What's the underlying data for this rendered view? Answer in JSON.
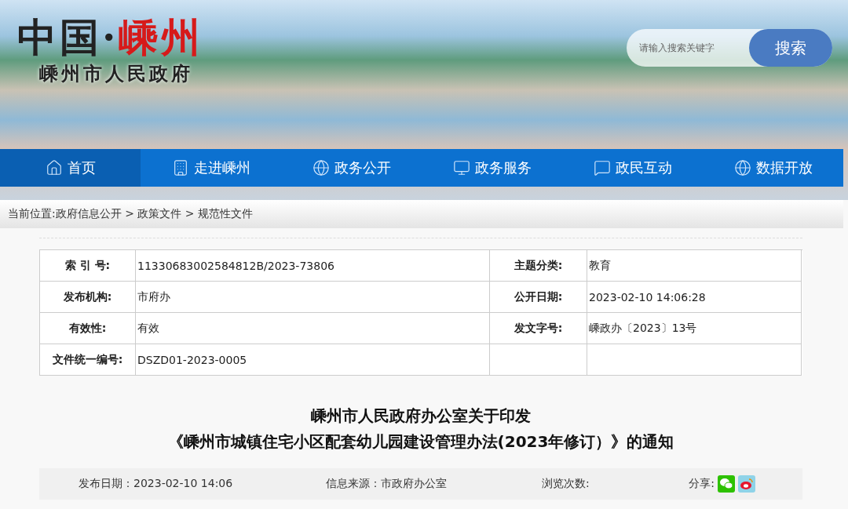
{
  "header": {
    "logo": {
      "title_lead": "中国·",
      "title_accent": "嵊州",
      "subtitle": "嵊州市人民政府"
    },
    "search": {
      "placeholder": "请输入搜索关键字",
      "button": "搜索"
    }
  },
  "nav": {
    "items": [
      {
        "label": "首页",
        "selected": true
      },
      {
        "label": "走进嵊州",
        "selected": false
      },
      {
        "label": "政务公开",
        "selected": false
      },
      {
        "label": "政务服务",
        "selected": false
      },
      {
        "label": "政民互动",
        "selected": false
      },
      {
        "label": "数据开放",
        "selected": false
      }
    ]
  },
  "breadcrumb": "当前位置:政府信息公开 > 政策文件 > 规范性文件",
  "info_table": {
    "rows": [
      {
        "cells": [
          {
            "label": "索 引 号:",
            "value": "11330683002584812B/2023-73806"
          },
          {
            "label": "主题分类:",
            "value": "教育"
          }
        ]
      },
      {
        "cells": [
          {
            "label": "发布机构:",
            "value": "市府办"
          },
          {
            "label": "公开日期:",
            "value": "2023-02-10 14:06:28"
          }
        ]
      },
      {
        "cells": [
          {
            "label": "有效性:",
            "value": "有效"
          },
          {
            "label": "发文字号:",
            "value": "嵊政办〔2023〕13号"
          }
        ]
      },
      {
        "cells": [
          {
            "label": "文件统一编号:",
            "value": "DSZD01-2023-0005"
          },
          {}
        ]
      }
    ]
  },
  "article": {
    "title_lines": [
      "嵊州市人民政府办公室关于印发",
      "《嵊州市城镇住宅小区配套幼儿园建设管理办法(2023年修订）》的通知"
    ],
    "meta": [
      "发布日期：2023-02-10 14:06",
      "信息来源：市政府办公室",
      "浏览次数:"
    ],
    "share_label": "分享:"
  }
}
